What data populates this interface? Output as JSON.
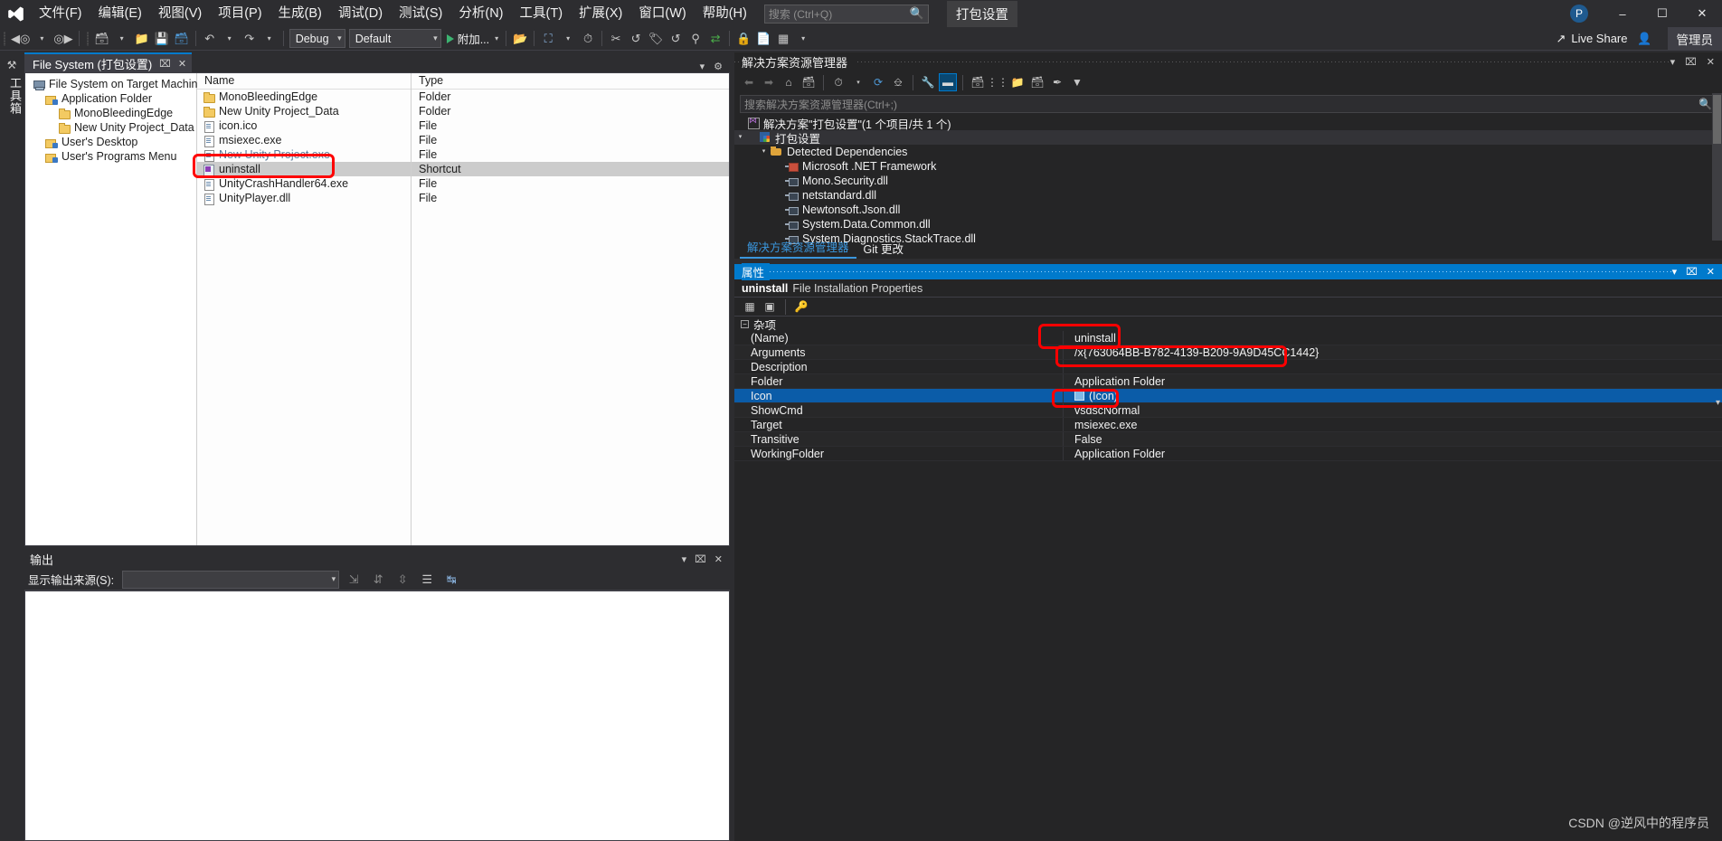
{
  "window": {
    "document_title": "打包设置",
    "user_initial": "P",
    "minimize": "–",
    "maximize": "❐",
    "close": "✕"
  },
  "menubar": {
    "items": [
      {
        "label": "文件(F)"
      },
      {
        "label": "编辑(E)"
      },
      {
        "label": "视图(V)"
      },
      {
        "label": "项目(P)"
      },
      {
        "label": "生成(B)"
      },
      {
        "label": "调试(D)"
      },
      {
        "label": "测试(S)"
      },
      {
        "label": "分析(N)"
      },
      {
        "label": "工具(T)"
      },
      {
        "label": "扩展(X)"
      },
      {
        "label": "窗口(W)"
      },
      {
        "label": "帮助(H)"
      }
    ],
    "search_placeholder": "搜索 (Ctrl+Q)",
    "search_icon": "search-icon"
  },
  "toolbar": {
    "back_icon": "navigate-back-icon",
    "forward_icon": "navigate-forward-icon",
    "new_project_icon": "new-project-icon",
    "open_icon": "open-folder-icon",
    "save_icon": "save-icon",
    "save_all_icon": "save-all-icon",
    "undo_icon": "undo-icon",
    "redo_icon": "redo-icon",
    "config_value": "Debug",
    "platform_value": "Default",
    "attach_label": "附加...",
    "snapshot_icon": "snapshot-icon",
    "iis_icon": "iis-icon",
    "timer_icon": "timer-icon",
    "cut_icon": "scissors-icon",
    "nav_icon": "navigate-icon",
    "tag_icon": "tag-icon",
    "history_icon": "history-icon",
    "branch_icon": "branch-icon",
    "sync_icon": "sync-icon",
    "lock_icon": "lock-icon",
    "copy_icon": "copy-icon",
    "grid_icon": "grid-icon",
    "live_share_label": "Live Share",
    "live_share_icon": "share-icon",
    "invite_icon": "invite-user-icon",
    "admin_label": "管理员"
  },
  "toolbox_strip": {
    "label": "工具箱",
    "icon": "toolbox-icon"
  },
  "designer": {
    "tab_label": "File System (打包设置)",
    "tab_pin_icon": "pin-icon",
    "tab_close_icon": "close-icon",
    "dropdown_icon": "chevron-down-icon",
    "settings_icon": "gear-icon",
    "tree": [
      {
        "label": "File System on Target Machine",
        "icon": "target-machine-icon",
        "indent": 0
      },
      {
        "label": "Application Folder",
        "icon": "special-folder-icon",
        "indent": 1
      },
      {
        "label": "MonoBleedingEdge",
        "icon": "folder-icon",
        "indent": 2
      },
      {
        "label": "New Unity Project_Data",
        "icon": "folder-icon",
        "indent": 2
      },
      {
        "label": "User's Desktop",
        "icon": "special-folder-icon",
        "indent": 1
      },
      {
        "label": "User's Programs Menu",
        "icon": "special-folder-icon",
        "indent": 1
      }
    ],
    "columns": {
      "name": "Name",
      "type": "Type"
    },
    "rows": [
      {
        "name": "MonoBleedingEdge",
        "type": "Folder",
        "icon": "folder-icon",
        "selected": false,
        "struck": false
      },
      {
        "name": "New Unity Project_Data",
        "type": "Folder",
        "icon": "folder-icon",
        "selected": false,
        "struck": false
      },
      {
        "name": "icon.ico",
        "type": "File",
        "icon": "file-icon",
        "selected": false,
        "struck": false
      },
      {
        "name": "msiexec.exe",
        "type": "File",
        "icon": "file-icon",
        "selected": false,
        "struck": false
      },
      {
        "name": "New Unity Project.exe",
        "type": "File",
        "icon": "file-icon",
        "selected": false,
        "struck": true
      },
      {
        "name": "uninstall",
        "type": "Shortcut",
        "icon": "shortcut-icon",
        "selected": true,
        "struck": false
      },
      {
        "name": "UnityCrashHandler64.exe",
        "type": "File",
        "icon": "file-icon",
        "selected": false,
        "struck": false
      },
      {
        "name": "UnityPlayer.dll",
        "type": "File",
        "icon": "file-icon",
        "selected": false,
        "struck": false
      }
    ]
  },
  "output": {
    "title": "输出",
    "dropdown_icon": "chevron-down-icon",
    "pin_icon": "pin-icon",
    "close_icon": "close-icon",
    "source_label": "显示输出来源(S):",
    "source_value": "",
    "combo_icon": "chevron-down-icon",
    "toolbar_icons": [
      "find-message-icon",
      "clear-all-icon",
      "go-to-next-icon",
      "wrap-text-icon",
      "toggle-word-wrap-icon"
    ]
  },
  "solution_explorer": {
    "title": "解决方案资源管理器",
    "dropdown_icon": "chevron-down-icon",
    "pin_icon": "pin-icon",
    "close_icon": "close-icon",
    "toolbar_icons": [
      "back-icon",
      "forward-icon",
      "home-icon",
      "pending-changes-icon",
      "sync-with-active-document-icon",
      "refresh-icon",
      "collapse-all-icon",
      "properties-icon",
      "show-all-files-icon",
      "preview-selected-items-icon",
      "new-folder-icon",
      "class-view-icon",
      "filter-icon",
      "search-filter-icon"
    ],
    "search_placeholder": "搜索解决方案资源管理器(Ctrl+;)",
    "search_icon": "search-icon",
    "tree": [
      {
        "label": "解决方案\"打包设置\"(1 个项目/共 1 个)",
        "icon": "solution-icon",
        "indent": 0,
        "chevron": "",
        "selected": false
      },
      {
        "label": "打包设置",
        "icon": "project-icon",
        "indent": 1,
        "chevron": "▾",
        "selected": true
      },
      {
        "label": "Detected Dependencies",
        "icon": "dependencies-folder-icon",
        "indent": 2,
        "chevron": "▾",
        "selected": false
      },
      {
        "label": "Microsoft .NET Framework",
        "icon": "framework-assembly-icon",
        "indent": 3,
        "chevron": "",
        "selected": false
      },
      {
        "label": "Mono.Security.dll",
        "icon": "assembly-icon",
        "indent": 3,
        "chevron": "",
        "selected": false
      },
      {
        "label": "netstandard.dll",
        "icon": "assembly-icon",
        "indent": 3,
        "chevron": "",
        "selected": false
      },
      {
        "label": "Newtonsoft.Json.dll",
        "icon": "assembly-icon",
        "indent": 3,
        "chevron": "",
        "selected": false
      },
      {
        "label": "System.Data.Common.dll",
        "icon": "assembly-icon",
        "indent": 3,
        "chevron": "",
        "selected": false
      },
      {
        "label": "System.Diagnostics.StackTrace.dll",
        "icon": "assembly-icon",
        "indent": 3,
        "chevron": "",
        "selected": false
      }
    ],
    "tabs": [
      {
        "label": "解决方案资源管理器",
        "active": true
      },
      {
        "label": "Git 更改",
        "active": false
      }
    ]
  },
  "properties": {
    "title": "属性",
    "dropdown_icon": "chevron-down-icon",
    "pin_icon": "pin-icon",
    "close_icon": "close-icon",
    "object_name": "uninstall",
    "object_type": "File Installation Properties",
    "toolbar_icons": [
      "categorized-icon",
      "alphabetical-icon",
      "property-pages-icon"
    ],
    "category": "杂项",
    "category_toggle": "−",
    "rows": [
      {
        "name": "(Name)",
        "value": "uninstall",
        "selected": false,
        "swatch": false
      },
      {
        "name": "Arguments",
        "value": "/x{763064BB-B782-4139-B209-9A9D45CC1442}",
        "selected": false,
        "swatch": false
      },
      {
        "name": "Description",
        "value": "",
        "selected": false,
        "swatch": false
      },
      {
        "name": "Folder",
        "value": "Application Folder",
        "selected": false,
        "swatch": false
      },
      {
        "name": "Icon",
        "value": "(Icon)",
        "selected": true,
        "swatch": true
      },
      {
        "name": "ShowCmd",
        "value": "vsdscNormal",
        "selected": false,
        "swatch": false
      },
      {
        "name": "Target",
        "value": "msiexec.exe",
        "selected": false,
        "swatch": false
      },
      {
        "name": "Transitive",
        "value": "False",
        "selected": false,
        "swatch": false
      },
      {
        "name": "WorkingFolder",
        "value": "Application Folder",
        "selected": false,
        "swatch": false
      }
    ]
  },
  "watermark": "CSDN @逆风中的程序员",
  "colors": {
    "accent": "#007acc",
    "annotation": "#fe0000",
    "chrome": "#2d2d30",
    "panel": "#252526",
    "selection": "#0b5ca8"
  }
}
